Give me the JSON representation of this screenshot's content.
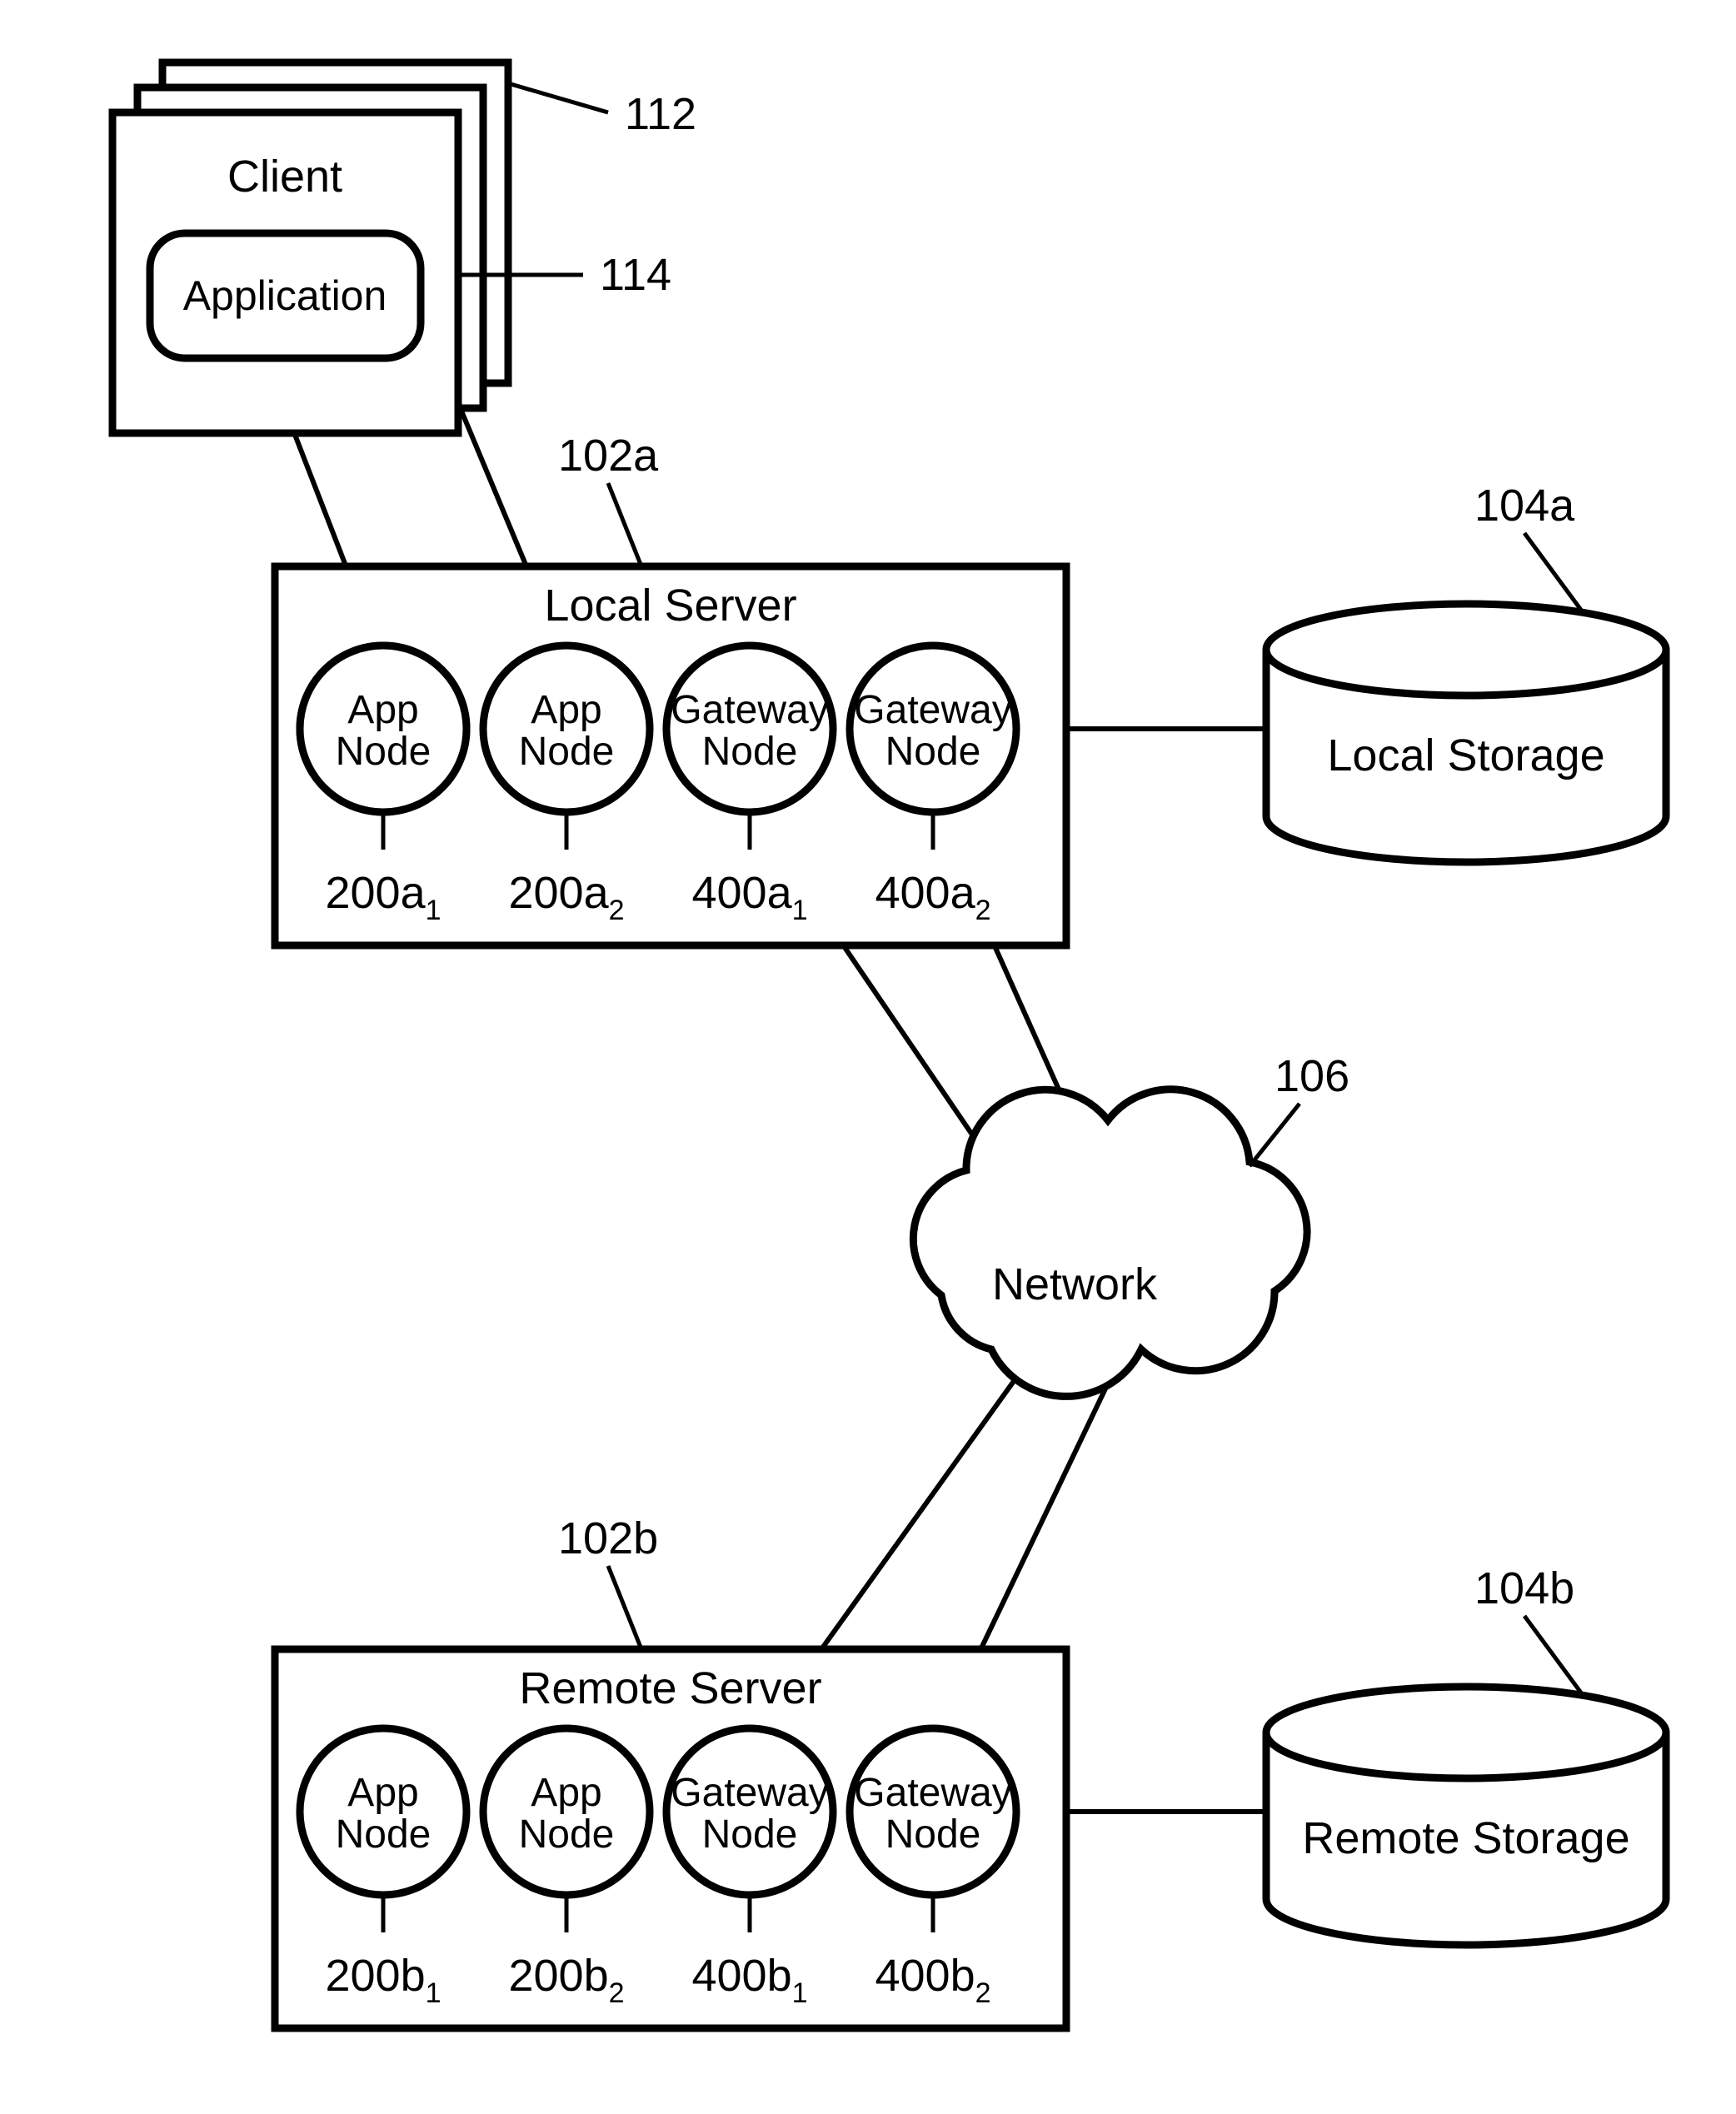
{
  "client": {
    "title": "Client",
    "app": "Application",
    "ref": "112",
    "app_ref": "114"
  },
  "local_server": {
    "title": "Local Server",
    "ref": "102a",
    "nodes": [
      {
        "l1": "App",
        "l2": "Node",
        "ref": "200a",
        "sub": "1"
      },
      {
        "l1": "App",
        "l2": "Node",
        "ref": "200a",
        "sub": "2"
      },
      {
        "l1": "Gateway",
        "l2": "Node",
        "ref": "400a",
        "sub": "1"
      },
      {
        "l1": "Gateway",
        "l2": "Node",
        "ref": "400a",
        "sub": "2"
      }
    ]
  },
  "local_storage": {
    "title": "Local Storage",
    "ref": "104a"
  },
  "network": {
    "title": "Network",
    "ref": "106"
  },
  "remote_server": {
    "title": "Remote Server",
    "ref": "102b",
    "nodes": [
      {
        "l1": "App",
        "l2": "Node",
        "ref": "200b",
        "sub": "1"
      },
      {
        "l1": "App",
        "l2": "Node",
        "ref": "200b",
        "sub": "2"
      },
      {
        "l1": "Gateway",
        "l2": "Node",
        "ref": "400b",
        "sub": "1"
      },
      {
        "l1": "Gateway",
        "l2": "Node",
        "ref": "400b",
        "sub": "2"
      }
    ]
  },
  "remote_storage": {
    "title": "Remote Storage",
    "ref": "104b"
  }
}
